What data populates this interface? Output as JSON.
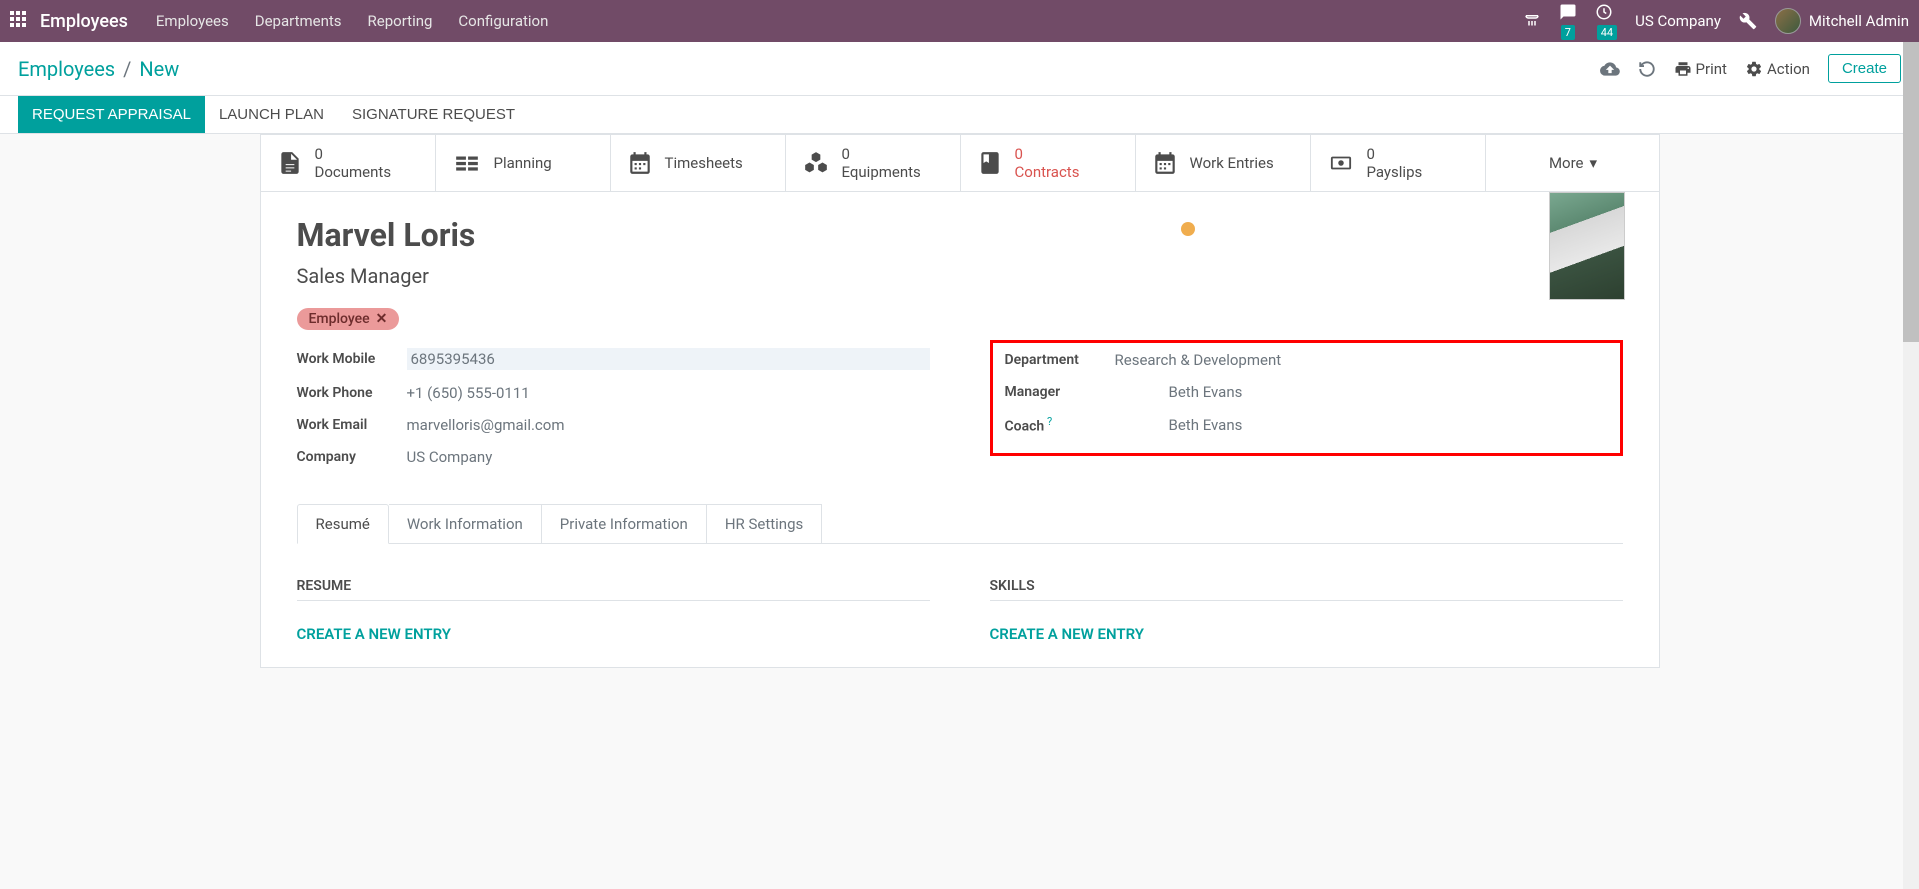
{
  "topbar": {
    "brand": "Employees",
    "menu": [
      "Employees",
      "Departments",
      "Reporting",
      "Configuration"
    ],
    "messaging_badge": "7",
    "activity_badge": "44",
    "company": "US Company",
    "user": "Mitchell Admin"
  },
  "control_panel": {
    "breadcrumb_root": "Employees",
    "breadcrumb_current": "New",
    "print": "Print",
    "action": "Action",
    "create": "Create"
  },
  "statusbar": {
    "request_appraisal": "REQUEST APPRAISAL",
    "launch_plan": "LAUNCH PLAN",
    "signature_request": "SIGNATURE REQUEST"
  },
  "stat_buttons": [
    {
      "count": "0",
      "label": "Documents",
      "icon": "file"
    },
    {
      "count": "",
      "label": "Planning",
      "icon": "calendar-list"
    },
    {
      "count": "",
      "label": "Timesheets",
      "icon": "calendar"
    },
    {
      "count": "0",
      "label": "Equipments",
      "icon": "cubes"
    },
    {
      "count": "0",
      "label": "Contracts",
      "icon": "book",
      "danger": true
    },
    {
      "count": "",
      "label": "Work Entries",
      "icon": "calendar"
    },
    {
      "count": "0",
      "label": "Payslips",
      "icon": "money"
    }
  ],
  "more_label": "More",
  "employee": {
    "name": "Marvel Loris",
    "title": "Sales Manager",
    "tag": "Employee"
  },
  "fields_left": {
    "work_mobile_label": "Work Mobile",
    "work_mobile": "6895395436",
    "work_phone_label": "Work Phone",
    "work_phone": "+1 (650) 555-0111",
    "work_email_label": "Work Email",
    "work_email": "marvelloris@gmail.com",
    "company_label": "Company",
    "company": "US Company"
  },
  "fields_right": {
    "department_label": "Department",
    "department": "Research & Development",
    "manager_label": "Manager",
    "manager": "Beth Evans",
    "coach_label": "Coach",
    "coach": "Beth Evans"
  },
  "tabs": [
    "Resumé",
    "Work Information",
    "Private Information",
    "HR Settings"
  ],
  "tab_content": {
    "resume_title": "RESUME",
    "skills_title": "SKILLS",
    "create_entry": "CREATE A NEW ENTRY"
  }
}
